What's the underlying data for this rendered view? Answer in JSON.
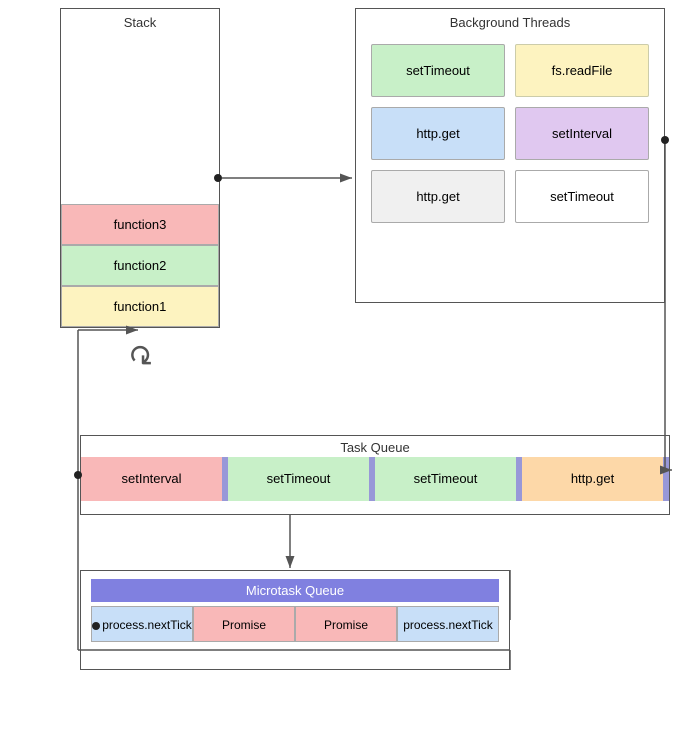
{
  "stack": {
    "label": "Stack",
    "items": [
      {
        "id": "func3",
        "text": "function3",
        "color": "func3"
      },
      {
        "id": "func2",
        "text": "function2",
        "color": "func2"
      },
      {
        "id": "func1",
        "text": "function1",
        "color": "func1"
      }
    ]
  },
  "background_threads": {
    "label": "Background Threads",
    "items": [
      {
        "text": "setTimeout",
        "color": "green"
      },
      {
        "text": "fs.readFile",
        "color": "yellow"
      },
      {
        "text": "http.get",
        "color": "blue"
      },
      {
        "text": "setInterval",
        "color": "purple"
      },
      {
        "text": "http.get",
        "color": "gray"
      },
      {
        "text": "setTimeout",
        "color": "white"
      }
    ]
  },
  "task_queue": {
    "label": "Task Queue",
    "items": [
      {
        "text": "setInterval",
        "color": "pink"
      },
      {
        "text": "setTimeout",
        "color": "green"
      },
      {
        "text": "setTimeout",
        "color": "green"
      },
      {
        "text": "http.get",
        "color": "orange"
      }
    ]
  },
  "microtask_queue": {
    "label": "Microtask Queue",
    "items": [
      {
        "text": "process.nextTick",
        "color": "blue",
        "dot": true
      },
      {
        "text": "Promise",
        "color": "pink"
      },
      {
        "text": "Promise",
        "color": "pink"
      },
      {
        "text": "process.nextTick",
        "color": "blue"
      }
    ]
  }
}
